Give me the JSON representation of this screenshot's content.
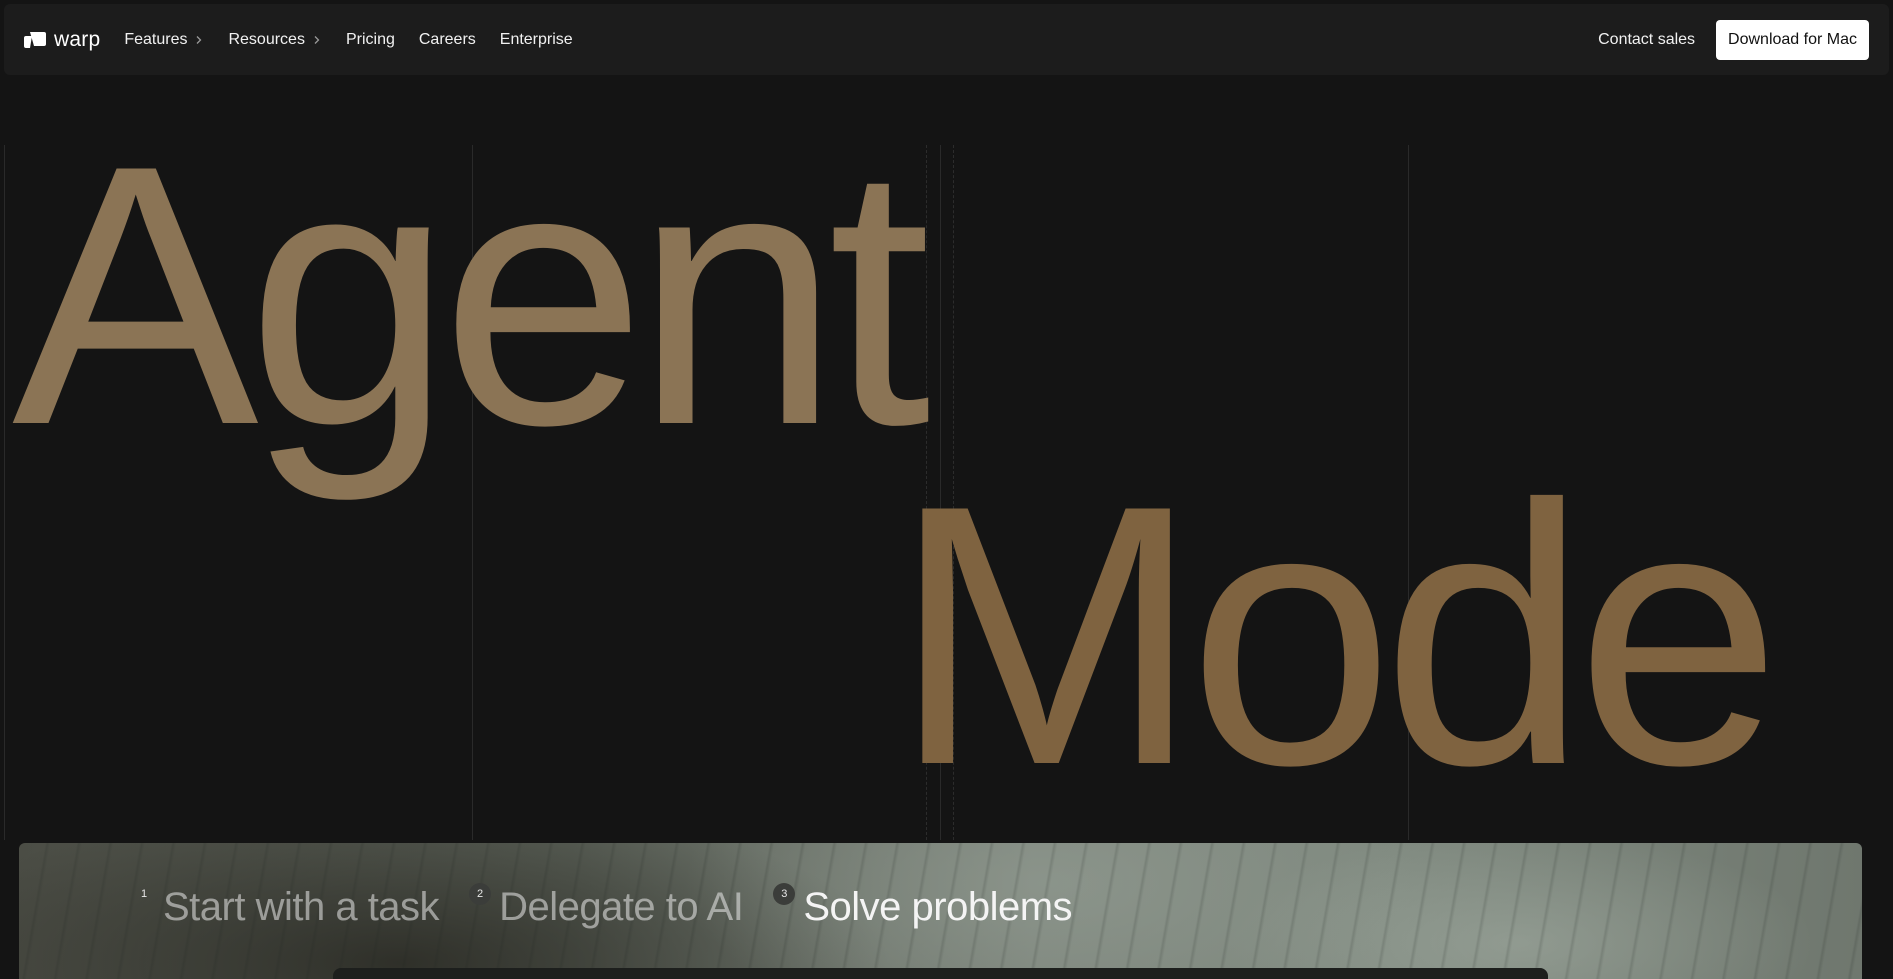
{
  "nav": {
    "logo_text": "warp",
    "menu": [
      {
        "label": "Features",
        "has_submenu": true
      },
      {
        "label": "Resources",
        "has_submenu": true
      },
      {
        "label": "Pricing",
        "has_submenu": false
      },
      {
        "label": "Careers",
        "has_submenu": false
      },
      {
        "label": "Enterprise",
        "has_submenu": false
      }
    ],
    "contact_label": "Contact sales",
    "download_label": "Download for Mac"
  },
  "hero": {
    "line1": "Agent",
    "line2": "Mode"
  },
  "steps": [
    {
      "number": "1",
      "label": "Start with a task",
      "active": false
    },
    {
      "number": "2",
      "label": "Delegate to AI",
      "active": false
    },
    {
      "number": "3",
      "label": "Solve problems",
      "active": true
    }
  ],
  "colors": {
    "background": "#141414",
    "nav_background": "#1c1c1c",
    "hero_text": "#8a7152",
    "button_background": "#ffffff"
  },
  "icons": {
    "logo": "warp-logo-icon",
    "submenu": "chevron-right-icon"
  }
}
